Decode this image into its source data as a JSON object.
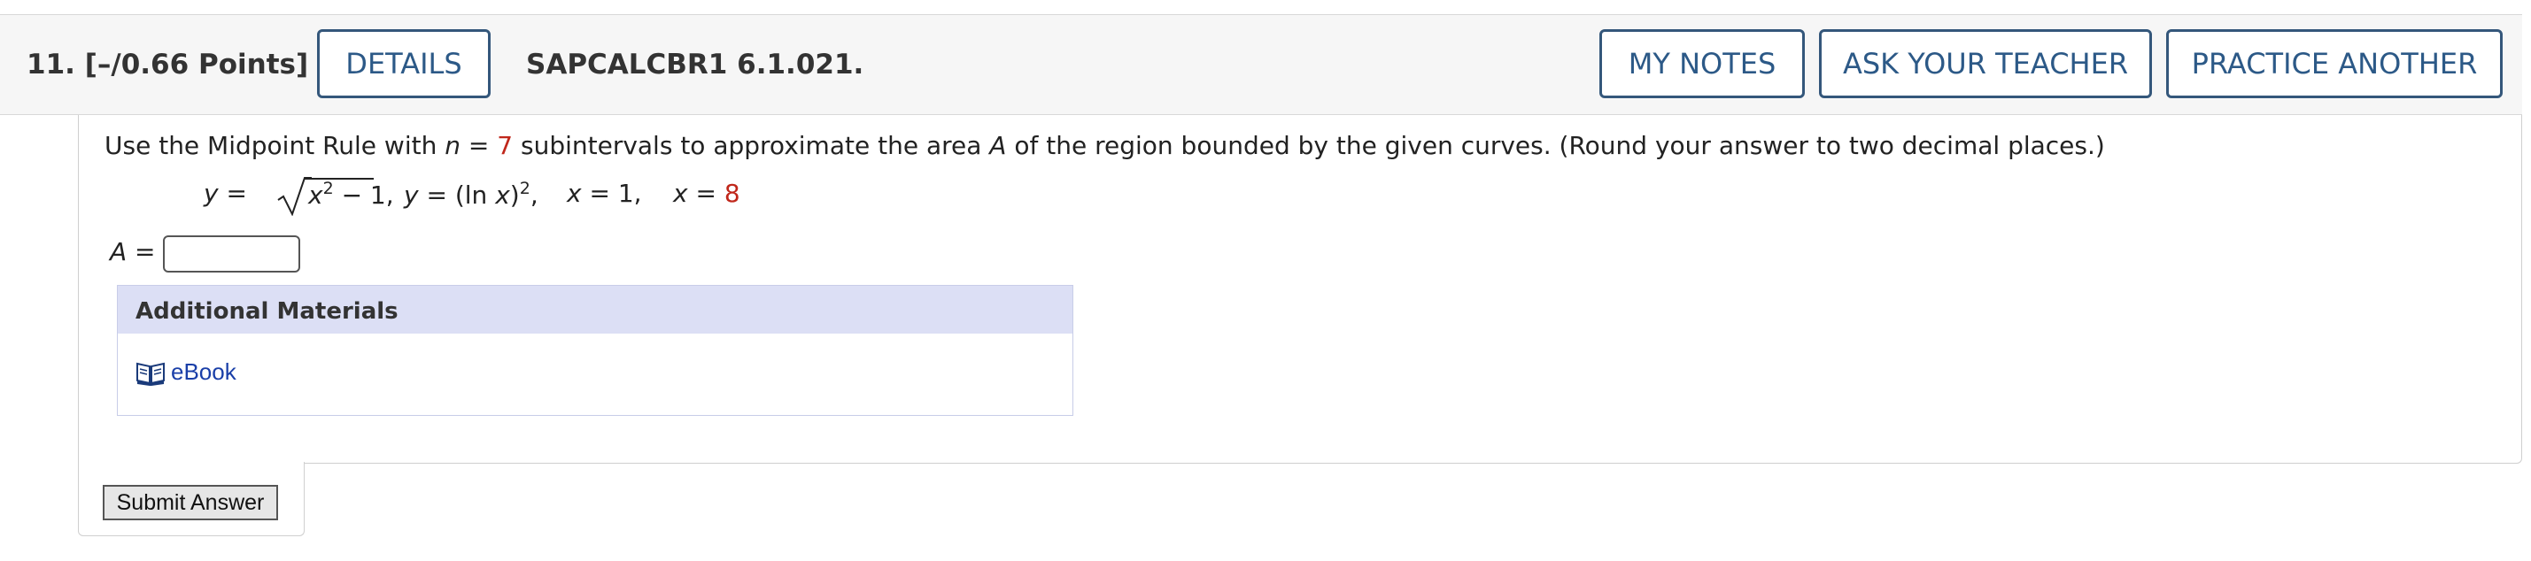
{
  "header": {
    "number": "11.",
    "points": "[–/0.66 Points]",
    "details_label": "DETAILS",
    "problem_code": "SAPCALCBR1 6.1.021.",
    "my_notes_label": "MY NOTES",
    "ask_teacher_label": "ASK YOUR TEACHER",
    "practice_another_label": "PRACTICE ANOTHER"
  },
  "question": {
    "prompt_start": "Use the Midpoint Rule with ",
    "n_var": "n",
    "equals": " = ",
    "n_value": "7",
    "prompt_mid": " subintervals to approximate the area ",
    "area_var": "A",
    "prompt_end": " of the region bounded by the given curves. (Round your answer to two decimal places.)",
    "curve1_lhs": "y",
    "curve1_radicand": "x",
    "curve1_exp": "2",
    "curve1_rest": " − 1",
    "curve2_lhs": "y",
    "curve2_rhs_pre": " = (ln ",
    "curve2_x": "x",
    "curve2_rhs_post": ")",
    "curve2_exp": "2",
    "bound1_var": "x",
    "bound1_val": " = 1,",
    "bound2_var": "x",
    "bound2_eq": " = ",
    "bound2_val": "8",
    "answer_label": "A",
    "answer_eq": " =",
    "answer_value": ""
  },
  "materials": {
    "title": "Additional Materials",
    "ebook_label": "eBook",
    "ebook_icon": "book-icon"
  },
  "submit_label": "Submit Answer",
  "colors": {
    "accent_button": "#2c5987",
    "highlight_value": "#c0271b",
    "materials_header": "#dcdff5",
    "link": "#1a3fa8"
  }
}
